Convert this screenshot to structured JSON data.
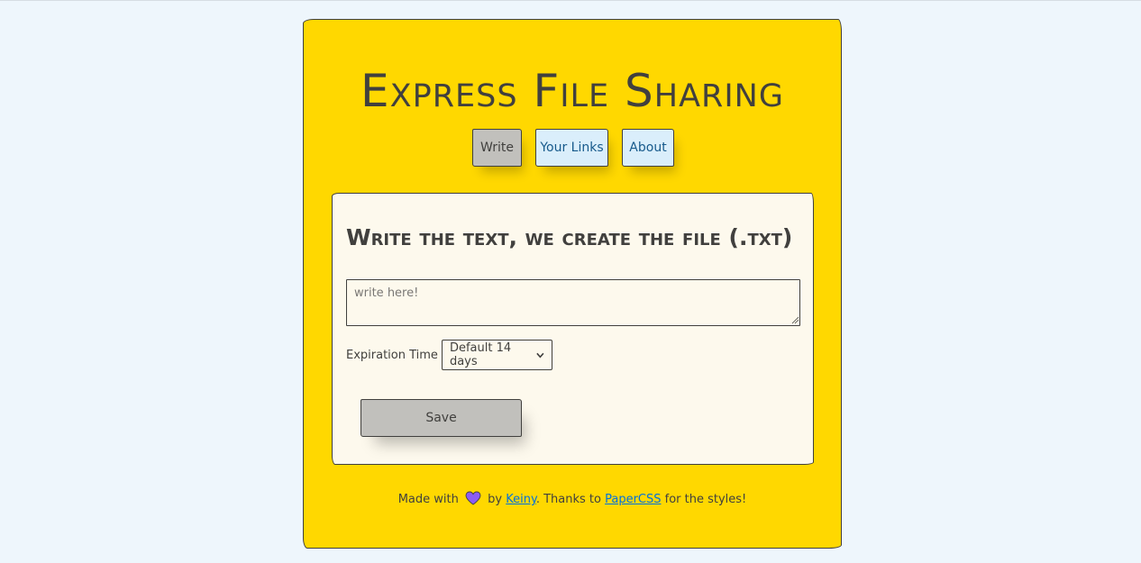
{
  "header": {
    "title": "Express File Sharing"
  },
  "nav": {
    "items": [
      {
        "label": "Write",
        "active": true
      },
      {
        "label": "Your Links",
        "active": false
      },
      {
        "label": "About",
        "active": false
      }
    ]
  },
  "form": {
    "title": "Write the text, we create the file (.txt)",
    "textarea": {
      "placeholder": "write here!",
      "value": ""
    },
    "expiration": {
      "label": "Expiration Time",
      "selected": "Default 14 days"
    },
    "save_label": "Save"
  },
  "footer": {
    "made_with": "Made with",
    "by": "by",
    "author": "Keiny",
    "thanks": ". Thanks to",
    "lib": "PaperCSS",
    "suffix": "for the styles!"
  },
  "colors": {
    "page_bg": "#eef6fc",
    "paper_bg": "#ffd800",
    "card_bg": "#fdf9ed",
    "active_tab": "#c1c0bc",
    "tab_bg": "#daeefb",
    "heart": "#8b5cf6",
    "link": "#0071de"
  },
  "icons": {
    "heart": "heart-icon",
    "select_chevron": "chevron-down-icon"
  }
}
